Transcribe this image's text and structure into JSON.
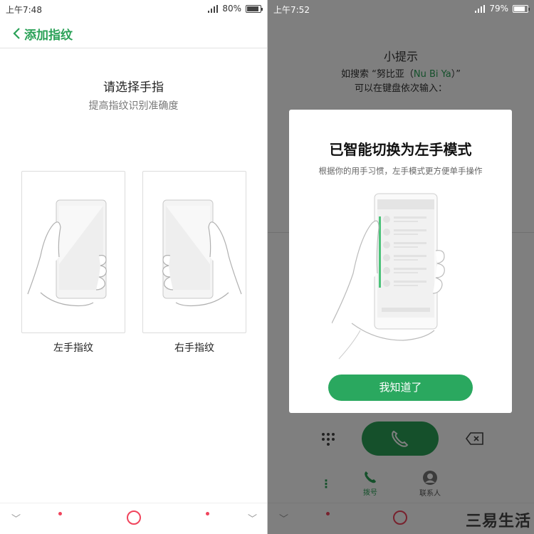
{
  "left": {
    "status": {
      "time": "上午7:48",
      "battery": "80%",
      "battery_level": 0.8
    },
    "topbar": {
      "title": "添加指纹"
    },
    "heading": "请选择手指",
    "subheading": "提高指纹识别准确度",
    "cards": [
      {
        "label": "左手指纹"
      },
      {
        "label": "右手指纹"
      }
    ]
  },
  "right": {
    "status": {
      "time": "上午7:52",
      "battery": "79%",
      "battery_level": 0.79
    },
    "tip": {
      "title": "小提示",
      "line1_pre": "如搜索 “努比亚（",
      "line1_green": "Nu Bi Ya",
      "line1_post": "）”",
      "line2": "可以在键盘依次输入："
    },
    "modal": {
      "title": "已智能切换为左手模式",
      "subtitle": "根据你的用手习惯，左手模式更方便单手操作",
      "button": "我知道了"
    },
    "tabs": [
      {
        "label": "拨号"
      },
      {
        "label": "联系人"
      }
    ],
    "watermark": "三易生活"
  },
  "colors": {
    "accent": "#2aa157",
    "nav_red": "#f0445c"
  }
}
